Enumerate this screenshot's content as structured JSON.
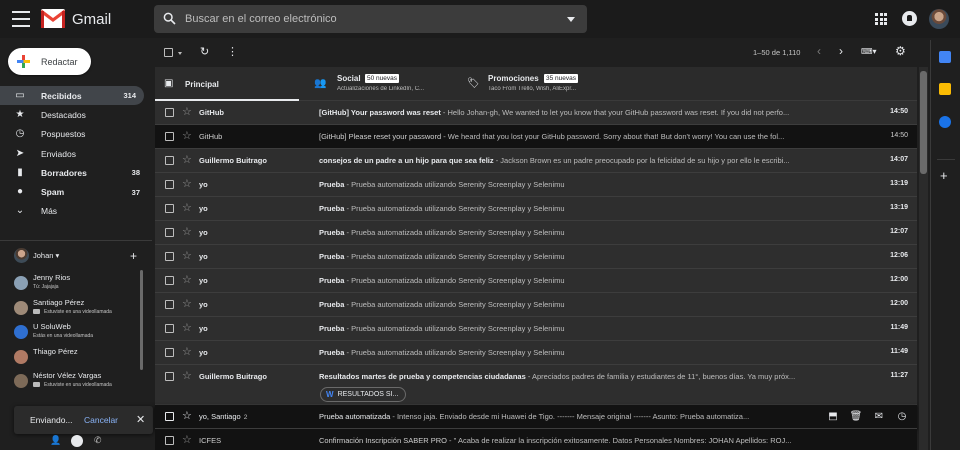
{
  "header": {
    "brand": "Gmail",
    "search_placeholder": "Buscar en el correo electrónico"
  },
  "compose_label": "Redactar",
  "sidebar": {
    "items": [
      {
        "label": "Recibidos",
        "count": "314",
        "icon": "inbox-icon",
        "glyph": "▭"
      },
      {
        "label": "Destacados",
        "count": "",
        "icon": "star-icon",
        "glyph": "★"
      },
      {
        "label": "Pospuestos",
        "count": "",
        "icon": "clock-icon",
        "glyph": "◷"
      },
      {
        "label": "Enviados",
        "count": "",
        "icon": "send-icon",
        "glyph": "➤"
      },
      {
        "label": "Borradores",
        "count": "38",
        "icon": "draft-icon",
        "glyph": "▮"
      },
      {
        "label": "Spam",
        "count": "37",
        "icon": "spam-icon",
        "glyph": "❗"
      },
      {
        "label": "Más",
        "count": "",
        "icon": "chevron-down-icon",
        "glyph": "⌄"
      }
    ]
  },
  "chat": {
    "user": "Johan ▾",
    "contacts": [
      {
        "name": "Jenny Rios",
        "status": "Tú: Jajajaja",
        "color": "#8aa0b4",
        "video": false
      },
      {
        "name": "Santiago Pérez",
        "status": "Estuviste en una videollamada",
        "color": "#9e8a78",
        "video": true
      },
      {
        "name": "U SoluWeb",
        "status": "Estás en una videollamada",
        "color": "#2f6fd0",
        "video": false
      },
      {
        "name": "Thiago Pérez",
        "status": "",
        "color": "#b07a64",
        "video": false
      },
      {
        "name": "Néstor Vélez Vargas",
        "status": "Estuviste en una videollamada",
        "color": "#7d6a58",
        "video": true
      }
    ]
  },
  "toast": {
    "text": "Enviando...",
    "cancel": "Cancelar"
  },
  "toolbar": {
    "range": "1–50 de 1,110"
  },
  "tabs": [
    {
      "name": "Principal",
      "badge": "",
      "sub": "",
      "icon": "inbox-tab-icon",
      "glyph": "▣"
    },
    {
      "name": "Social",
      "badge": "50 nuevas",
      "sub": "Actualizaciones de LinkedIn, C...",
      "icon": "people-icon",
      "glyph": "👥"
    },
    {
      "name": "Promociones",
      "badge": "35 nuevas",
      "sub": "Taco From Trello, Wish, AliExpr...",
      "icon": "tag-icon",
      "glyph": "🏷"
    }
  ],
  "emails": [
    {
      "sender": "GitHub",
      "subject": "[GitHub] Your password was reset",
      "snippet": " - Hello Johan-gh, We wanted to let you know that your GitHub password was reset. If you did not perfo...",
      "time": "14:50",
      "state": "unread"
    },
    {
      "sender": "GitHub",
      "subject": "[GitHub] Please reset your password",
      "snippet": " - We heard that you lost your GitHub password. Sorry about that! But don't worry! You can use the fol...",
      "time": "14:50",
      "state": "read"
    },
    {
      "sender": "Guillermo Buitrago",
      "subject": "consejos de un padre a un hijo para que sea feliz",
      "snippet": " - Jackson Brown es un padre preocupado por la felicidad de su hijo y por ello le escribi...",
      "time": "14:07",
      "state": "unread"
    },
    {
      "sender": "yo",
      "subject": "Prueba",
      "snippet": " - Prueba automatizada utilizando Serenity Screenplay y Selenimu",
      "time": "13:19",
      "state": "unread"
    },
    {
      "sender": "yo",
      "subject": "Prueba",
      "snippet": " - Prueba automatizada utilizando Serenity Screenplay y Selenimu",
      "time": "13:19",
      "state": "unread"
    },
    {
      "sender": "yo",
      "subject": "Prueba",
      "snippet": " - Prueba automatizada utilizando Serenity Screenplay y Selenimu",
      "time": "12:07",
      "state": "unread"
    },
    {
      "sender": "yo",
      "subject": "Prueba",
      "snippet": " - Prueba automatizada utilizando Serenity Screenplay y Selenimu",
      "time": "12:06",
      "state": "unread"
    },
    {
      "sender": "yo",
      "subject": "Prueba",
      "snippet": " - Prueba automatizada utilizando Serenity Screenplay y Selenimu",
      "time": "12:00",
      "state": "unread"
    },
    {
      "sender": "yo",
      "subject": "Prueba",
      "snippet": " - Prueba automatizada utilizando Serenity Screenplay y Selenimu",
      "time": "12:00",
      "state": "unread"
    },
    {
      "sender": "yo",
      "subject": "Prueba",
      "snippet": " - Prueba automatizada utilizando Serenity Screenplay y Selenimu",
      "time": "11:49",
      "state": "unread"
    },
    {
      "sender": "yo",
      "subject": "Prueba",
      "snippet": " - Prueba automatizada utilizando Serenity Screenplay y Selenimu",
      "time": "11:49",
      "state": "unread"
    },
    {
      "sender": "Guillermo Buitrago",
      "subject": "Resultados martes de prueba y competencias ciudadanas",
      "snippet": " - Apreciados padres de familia y estudiantes de 11°, buenos días. Ya muy próx...",
      "time": "11:27",
      "state": "unread",
      "attachment": "RESULTADOS SI..."
    },
    {
      "sender": "yo, Santiago",
      "count": "2",
      "subject": "Prueba automatizada",
      "snippet": " - Intenso jaja. Enviado desde mi Huawei de Tigo. ------- Mensaje original ------- Asunto: Prueba automatiza...",
      "time": "",
      "state": "hover"
    },
    {
      "sender": "ICFES",
      "subject": "Confirmación Inscripción SABER PRO",
      "snippet": " - \" Acaba de realizar la inscripción exitosamente. Datos Personales Nombres: JOHAN Apellidos: ROJ...",
      "time": "",
      "state": "read"
    }
  ]
}
